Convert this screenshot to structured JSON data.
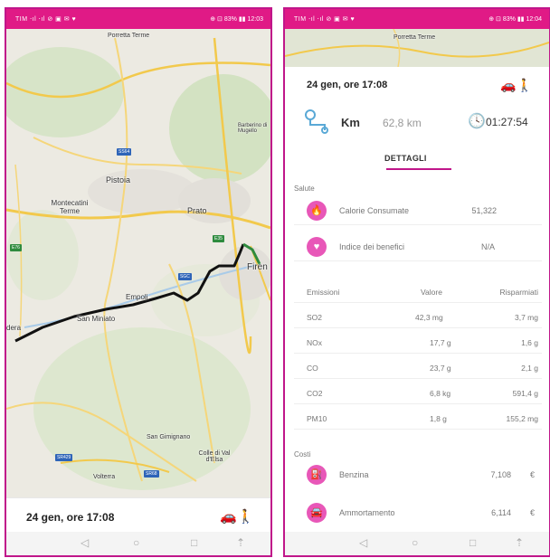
{
  "status_bar": {
    "left": "TIM ⋅ıl ⋅ıl ⊘ ▣ ✉ ♥",
    "right_left": "⊕ ⊡ 83% ▮▮ 12:03",
    "right_right": "⊕ ⊡ 83% ▮▮ 12:04"
  },
  "map_labels": {
    "porretta": "Porretta Terme",
    "barberino": "Barberino di Mugello",
    "pistoia": "Pistoia",
    "montecatini": "Montecatini Terme",
    "prato": "Prato",
    "firenze": "Firen",
    "empoli": "Empoli",
    "san_miniato": "San Miniato",
    "pontedera": "dera",
    "san_gimignano": "San Gimignano",
    "colle": "Colle di Val d'Elsa",
    "volterra": "Volterra",
    "road_e76": "E76",
    "road_e35": "E35",
    "road_ss64": "SS64",
    "road_sgc": "SGC",
    "road_sr429": "SR429",
    "road_sr68": "SR68"
  },
  "trip": {
    "date": "24 gen, ore 17:08",
    "unit": "Km",
    "distance": "62,8 km",
    "duration": "01:27:54",
    "tab": "DETTAGLI"
  },
  "health": {
    "section": "Salute",
    "rows": [
      {
        "label": "Calorie Consumate",
        "value": "51,322"
      },
      {
        "label": "Indice dei benefici",
        "value": "N/A"
      }
    ]
  },
  "emissions": {
    "headers": [
      "Emissioni",
      "Valore",
      "Risparmiati"
    ],
    "rows": [
      [
        "SO2",
        "42,3 mg",
        "3,7 mg"
      ],
      [
        "NOx",
        "17,7 g",
        "1,6 g"
      ],
      [
        "CO",
        "23,7 g",
        "2,1 g"
      ],
      [
        "CO2",
        "6,8 kg",
        "591,4 g"
      ],
      [
        "PM10",
        "1,8 g",
        "155,2 mg"
      ]
    ]
  },
  "costs": {
    "section": "Costi",
    "rows": [
      {
        "label": "Benzina",
        "value": "7,108",
        "currency": "€"
      },
      {
        "label": "Ammortamento",
        "value": "6,114",
        "currency": "€"
      }
    ]
  },
  "icons": {
    "car": "car-icon",
    "walk": "walk-icon",
    "clock": "clock-icon",
    "route": "route-icon"
  }
}
